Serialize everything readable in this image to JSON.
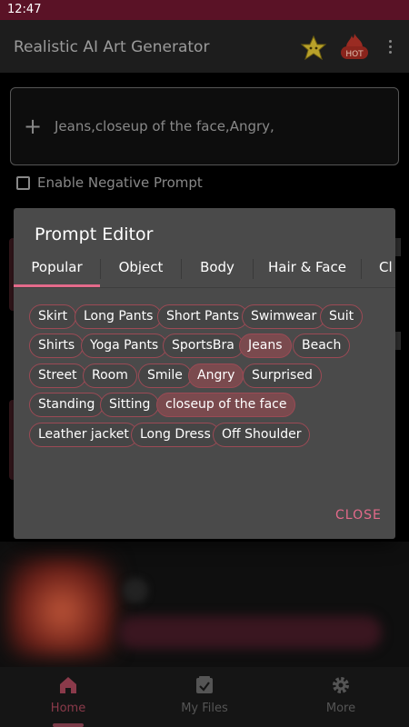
{
  "status_bar": {
    "time": "12:47"
  },
  "app_bar": {
    "title": "Realistic AI Art Generator",
    "hot_badge": "HOT"
  },
  "prompt": {
    "text": "Jeans,closeup of the face,Angry,"
  },
  "negative_prompt": {
    "label": "Enable Negative Prompt",
    "checked": false
  },
  "dialog": {
    "title": "Prompt Editor",
    "tabs": [
      {
        "label": "Popular",
        "active": true
      },
      {
        "label": "Object",
        "active": false
      },
      {
        "label": "Body",
        "active": false
      },
      {
        "label": "Hair & Face",
        "active": false
      },
      {
        "label": "Cl",
        "active": false
      }
    ],
    "chips": [
      {
        "label": "Skirt",
        "selected": false
      },
      {
        "label": "Long Pants",
        "selected": false
      },
      {
        "label": "Short Pants",
        "selected": false
      },
      {
        "label": "Swimwear",
        "selected": false
      },
      {
        "label": "Suit",
        "selected": false
      },
      {
        "label": "Shirts",
        "selected": false
      },
      {
        "label": "Yoga Pants",
        "selected": false
      },
      {
        "label": "SportsBra",
        "selected": false
      },
      {
        "label": "Jeans",
        "selected": true
      },
      {
        "label": "Beach",
        "selected": false
      },
      {
        "label": "Street",
        "selected": false
      },
      {
        "label": "Room",
        "selected": false
      },
      {
        "label": "Smile",
        "selected": false
      },
      {
        "label": "Angry",
        "selected": true
      },
      {
        "label": "Surprised",
        "selected": false
      },
      {
        "label": "Standing",
        "selected": false
      },
      {
        "label": "Sitting",
        "selected": false
      },
      {
        "label": "closeup of the face",
        "selected": true
      },
      {
        "label": "Leather jacket",
        "selected": false
      },
      {
        "label": "Long Dress",
        "selected": false
      },
      {
        "label": "Off Shoulder",
        "selected": false
      }
    ],
    "close_label": "CLOSE"
  },
  "bottom_nav": {
    "items": [
      {
        "label": "Home",
        "icon": "home-icon",
        "active": true
      },
      {
        "label": "My Files",
        "icon": "files-icon",
        "active": false
      },
      {
        "label": "More",
        "icon": "gear-icon",
        "active": false
      }
    ]
  },
  "colors": {
    "accent": "#e46a8a",
    "status_bar": "#5a1226",
    "chip_border": "#9c4a55",
    "chip_selected": "#7a4a4e",
    "dialog_bg": "#4a4a4a"
  }
}
